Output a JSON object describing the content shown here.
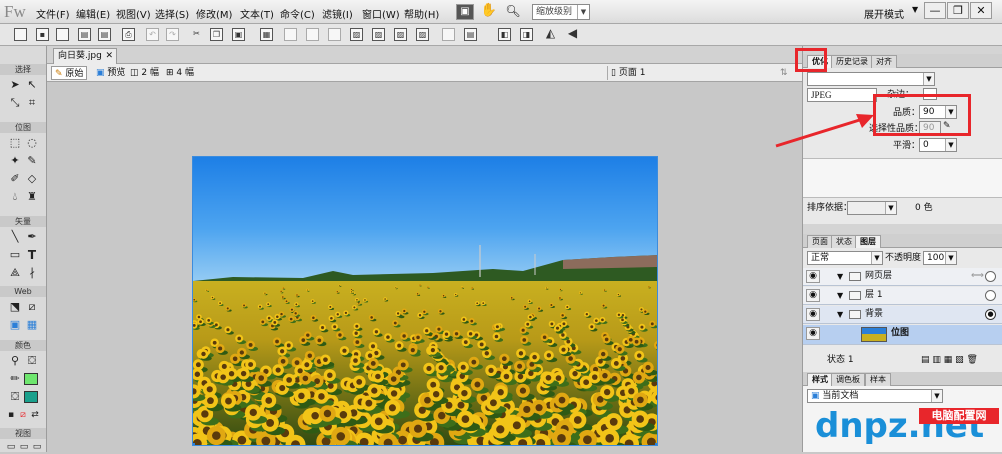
{
  "app": {
    "logo": "Fw",
    "mode": "展开模式",
    "zoom_label": "缩放级别"
  },
  "menu": [
    "文件(F)",
    "编辑(E)",
    "视图(V)",
    "选择(S)",
    "修改(M)",
    "文本(T)",
    "命令(C)",
    "滤镜(I)",
    "窗口(W)",
    "帮助(H)"
  ],
  "tools": {
    "sections": [
      "选择",
      "位图",
      "矢量",
      "Web",
      "颜色",
      "视图"
    ]
  },
  "document": {
    "tab_name": "向日葵.jpg",
    "views": [
      "原始",
      "预览",
      "2 幅",
      "4 幅"
    ],
    "page_label": "页面 1"
  },
  "optimize_panel": {
    "tabs": [
      "优化",
      "历史记录",
      "对齐"
    ],
    "format": "JPEG",
    "matte_label": "杂边：",
    "quality_label": "品质：",
    "quality_value": "90",
    "selective_quality_label": "选择性品质：",
    "selective_quality_value": "90",
    "smoothing_label": "平滑：",
    "smoothing_value": "0",
    "sort_by_label": "排序依据：",
    "colors_count": "0 色"
  },
  "layers_panel": {
    "tabs": [
      "页面",
      "状态",
      "图层"
    ],
    "blend_mode": "正常",
    "opacity_label": "不透明度",
    "opacity_value": "100",
    "layers": [
      {
        "name": "网页层"
      },
      {
        "name": "层 1"
      },
      {
        "name": "背景"
      },
      {
        "name": "位图"
      }
    ],
    "status": "状态 1"
  },
  "styles_panel": {
    "tabs": [
      "样式",
      "调色板",
      "样本"
    ],
    "doc_select": "当前文档"
  },
  "watermark": {
    "brand": "dnpz.net",
    "site": "电脑配置网"
  },
  "colors": {
    "highlight_red": "#e8262b",
    "selection_blue": "#2b7fd8",
    "stroke_green": "#6ee66e",
    "fill_teal": "#1aa08c"
  }
}
